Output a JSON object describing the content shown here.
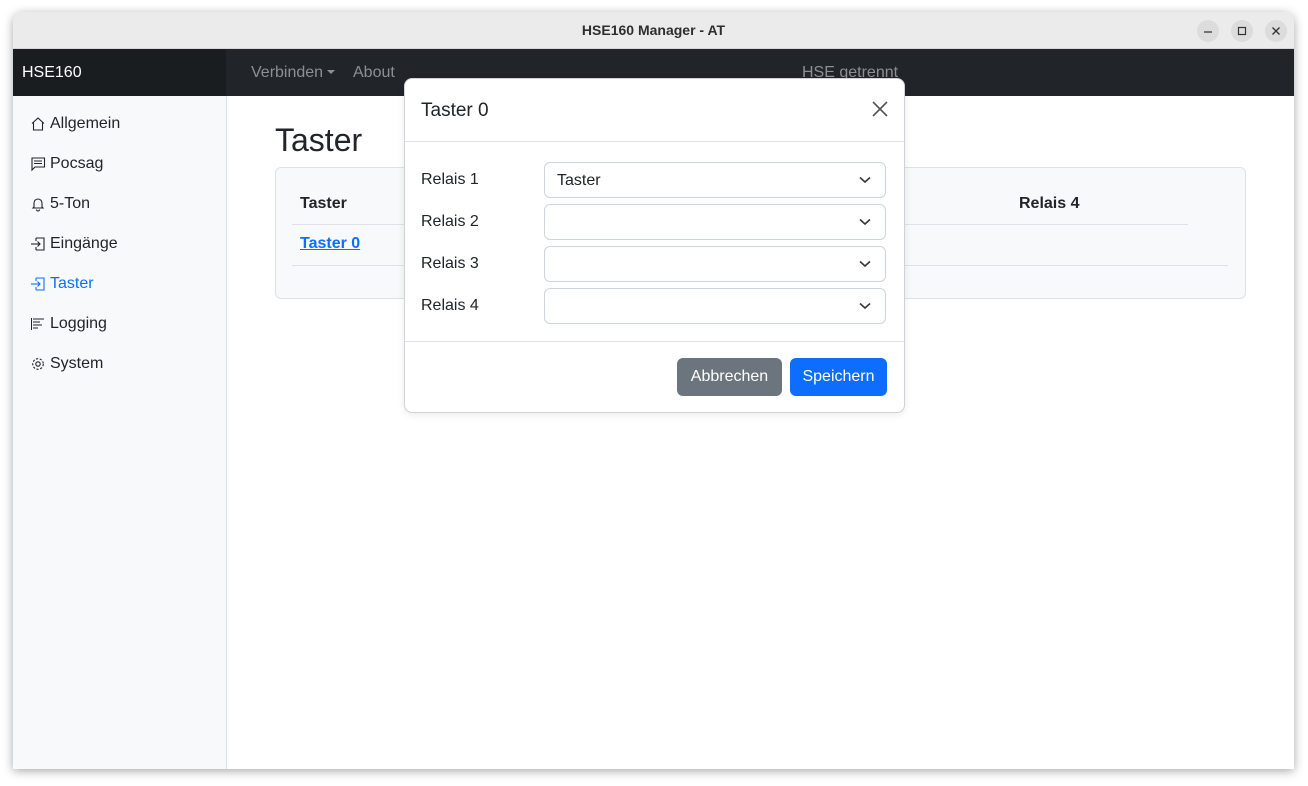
{
  "window": {
    "title": "HSE160 Manager - AT"
  },
  "navbar": {
    "brand": "HSE160",
    "connect_label": "Verbinden",
    "about_label": "About",
    "status": "HSE getrennt"
  },
  "sidebar": {
    "items": [
      {
        "label": "Allgemein",
        "icon": "house-icon"
      },
      {
        "label": "Pocsag",
        "icon": "message-icon"
      },
      {
        "label": "5-Ton",
        "icon": "bell-icon"
      },
      {
        "label": "Eingänge",
        "icon": "box-arrow-in-icon"
      },
      {
        "label": "Taster",
        "icon": "box-arrow-in-icon",
        "active": true
      },
      {
        "label": "Logging",
        "icon": "list-bars-icon"
      },
      {
        "label": "System",
        "icon": "gear-icon"
      }
    ]
  },
  "main": {
    "title": "Taster",
    "table": {
      "headers": [
        "Taster",
        "Relais 4"
      ],
      "rows": [
        {
          "taster": "Taster 0"
        }
      ]
    }
  },
  "modal": {
    "title": "Taster 0",
    "fields": [
      {
        "label": "Relais 1",
        "value": "Taster"
      },
      {
        "label": "Relais 2",
        "value": ""
      },
      {
        "label": "Relais 3",
        "value": ""
      },
      {
        "label": "Relais 4",
        "value": ""
      }
    ],
    "cancel_label": "Abbrechen",
    "save_label": "Speichern"
  },
  "colors": {
    "accent": "#0d6efd",
    "navbar": "#212529",
    "cancel": "#6c757d"
  }
}
